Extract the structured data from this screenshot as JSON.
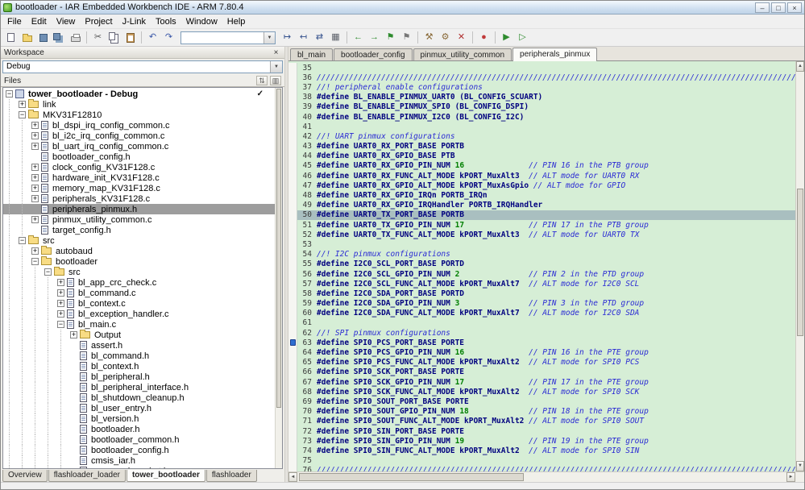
{
  "window": {
    "title": "bootloader - IAR Embedded Workbench IDE - ARM 7.80.4",
    "controls": [
      {
        "name": "minimize-button",
        "glyph": "–"
      },
      {
        "name": "maximize-button",
        "glyph": "□"
      },
      {
        "name": "close-button",
        "glyph": "×"
      }
    ]
  },
  "menu": {
    "items": [
      "File",
      "Edit",
      "View",
      "Project",
      "J-Link",
      "Tools",
      "Window",
      "Help"
    ]
  },
  "toolbar": {
    "items": [
      {
        "type": "icon",
        "name": "new-document-icon",
        "shape": "page"
      },
      {
        "type": "icon",
        "name": "open-file-icon",
        "shape": "folder"
      },
      {
        "type": "icon",
        "name": "save-icon",
        "shape": "floppy"
      },
      {
        "type": "icon",
        "name": "save-all-icon",
        "shape": "floppy2"
      },
      {
        "type": "icon",
        "name": "print-icon",
        "shape": "printer"
      },
      {
        "type": "sep"
      },
      {
        "type": "icon",
        "name": "cut-icon",
        "glyph": "✂",
        "color": "#555555"
      },
      {
        "type": "icon",
        "name": "copy-icon",
        "shape": "copy"
      },
      {
        "type": "icon",
        "name": "paste-icon",
        "shape": "paste"
      },
      {
        "type": "sep"
      },
      {
        "type": "icon",
        "name": "undo-icon",
        "glyph": "↶",
        "color": "#3a57a8"
      },
      {
        "type": "icon",
        "name": "redo-icon",
        "glyph": "↷",
        "color": "#3a57a8"
      },
      {
        "type": "combo",
        "name": "find-combo",
        "value": ""
      },
      {
        "type": "icon",
        "name": "find-next-icon",
        "glyph": "↦",
        "color": "#33508c"
      },
      {
        "type": "icon",
        "name": "find-previous-icon",
        "glyph": "↤",
        "color": "#33508c"
      },
      {
        "type": "icon",
        "name": "replace-icon",
        "glyph": "⇄",
        "color": "#33508c"
      },
      {
        "type": "icon",
        "name": "browse-symbols-icon",
        "glyph": "▦",
        "color": "#5a5f68"
      },
      {
        "type": "sep"
      },
      {
        "type": "icon",
        "name": "navigate-backward-icon",
        "glyph": "←",
        "color": "#2e8b2e"
      },
      {
        "type": "icon",
        "name": "navigate-forward-icon",
        "glyph": "→",
        "color": "#2e8b2e"
      },
      {
        "type": "icon",
        "name": "goto-bookmark-icon",
        "glyph": "⚑",
        "color": "#2e8b2e"
      },
      {
        "type": "icon",
        "name": "toggle-bookmark-icon",
        "glyph": "⚑",
        "color": "#777777"
      },
      {
        "type": "sep"
      },
      {
        "type": "icon",
        "name": "make-icon",
        "glyph": "⚒",
        "color": "#8a6b3a"
      },
      {
        "type": "icon",
        "name": "compile-icon",
        "glyph": "⚙",
        "color": "#8a6b3a"
      },
      {
        "type": "icon",
        "name": "stop-build-icon",
        "glyph": "✕",
        "color": "#b03030"
      },
      {
        "type": "sep"
      },
      {
        "type": "icon",
        "name": "toggle-breakpoint-icon",
        "glyph": "●",
        "color": "#c03a3a"
      },
      {
        "type": "sep"
      },
      {
        "type": "icon",
        "name": "download-and-debug-icon",
        "glyph": "▶",
        "color": "#2e8b2e"
      },
      {
        "type": "icon",
        "name": "debug-without-downloading-icon",
        "glyph": "▷",
        "color": "#2e8b2e"
      }
    ]
  },
  "workspace": {
    "header": "Workspace",
    "config_selector": "Debug",
    "files_header": "Files",
    "files_icons": [
      {
        "name": "files-sort-icon",
        "glyph": "⇅"
      },
      {
        "name": "files-columns-icon",
        "glyph": "▥"
      }
    ],
    "tree": [
      {
        "label": "tower_bootloader - Debug",
        "level": 0,
        "icon": "project",
        "expander": "minus",
        "bold": true,
        "check": true
      },
      {
        "label": "link",
        "level": 1,
        "icon": "folder",
        "expander": "plus"
      },
      {
        "label": "MKV31F12810",
        "level": 1,
        "icon": "folder",
        "expander": "minus"
      },
      {
        "label": "bl_dspi_irq_config_common.c",
        "level": 2,
        "icon": "file",
        "expander": "plus"
      },
      {
        "label": "bl_i2c_irq_config_common.c",
        "level": 2,
        "icon": "file",
        "expander": "plus"
      },
      {
        "label": "bl_uart_irq_config_common.c",
        "level": 2,
        "icon": "file",
        "expander": "plus"
      },
      {
        "label": "bootloader_config.h",
        "level": 2,
        "icon": "file",
        "expander": "none"
      },
      {
        "label": "clock_config_KV31F128.c",
        "level": 2,
        "icon": "file",
        "expander": "plus"
      },
      {
        "label": "hardware_init_KV31F128.c",
        "level": 2,
        "icon": "file",
        "expander": "plus"
      },
      {
        "label": "memory_map_KV31F128.c",
        "level": 2,
        "icon": "file",
        "expander": "plus"
      },
      {
        "label": "peripherals_KV31F128.c",
        "level": 2,
        "icon": "file",
        "expander": "plus"
      },
      {
        "label": "peripherals_pinmux.h",
        "level": 2,
        "icon": "file",
        "expander": "none",
        "selected": true
      },
      {
        "label": "pinmux_utility_common.c",
        "level": 2,
        "icon": "file",
        "expander": "plus"
      },
      {
        "label": "target_config.h",
        "level": 2,
        "icon": "file",
        "expander": "none"
      },
      {
        "label": "src",
        "level": 1,
        "icon": "folder",
        "expander": "minus"
      },
      {
        "label": "autobaud",
        "level": 2,
        "icon": "folder",
        "expander": "plus"
      },
      {
        "label": "bootloader",
        "level": 2,
        "icon": "folder",
        "expander": "minus"
      },
      {
        "label": "src",
        "level": 3,
        "icon": "folder",
        "expander": "minus"
      },
      {
        "label": "bl_app_crc_check.c",
        "level": 4,
        "icon": "file",
        "expander": "plus"
      },
      {
        "label": "bl_command.c",
        "level": 4,
        "icon": "file",
        "expander": "plus"
      },
      {
        "label": "bl_context.c",
        "level": 4,
        "icon": "file",
        "expander": "plus"
      },
      {
        "label": "bl_exception_handler.c",
        "level": 4,
        "icon": "file",
        "expander": "plus"
      },
      {
        "label": "bl_main.c",
        "level": 4,
        "icon": "file",
        "expander": "minus"
      },
      {
        "label": "Output",
        "level": 5,
        "icon": "folder",
        "expander": "plus"
      },
      {
        "label": "assert.h",
        "level": 5,
        "icon": "file",
        "expander": "none"
      },
      {
        "label": "bl_command.h",
        "level": 5,
        "icon": "file",
        "expander": "none"
      },
      {
        "label": "bl_context.h",
        "level": 5,
        "icon": "file",
        "expander": "none"
      },
      {
        "label": "bl_peripheral.h",
        "level": 5,
        "icon": "file",
        "expander": "none"
      },
      {
        "label": "bl_peripheral_interface.h",
        "level": 5,
        "icon": "file",
        "expander": "none"
      },
      {
        "label": "bl_shutdown_cleanup.h",
        "level": 5,
        "icon": "file",
        "expander": "none"
      },
      {
        "label": "bl_user_entry.h",
        "level": 5,
        "icon": "file",
        "expander": "none"
      },
      {
        "label": "bl_version.h",
        "level": 5,
        "icon": "file",
        "expander": "none"
      },
      {
        "label": "bootloader.h",
        "level": 5,
        "icon": "file",
        "expander": "none"
      },
      {
        "label": "bootloader_common.h",
        "level": 5,
        "icon": "file",
        "expander": "none"
      },
      {
        "label": "bootloader_config.h",
        "level": 5,
        "icon": "file",
        "expander": "none"
      },
      {
        "label": "cmsis_iar.h",
        "level": 5,
        "icon": "file",
        "expander": "none"
      },
      {
        "label": "command_packet.h",
        "level": 5,
        "icon": "file",
        "expander": "none"
      }
    ],
    "tabs": [
      {
        "label": "Overview"
      },
      {
        "label": "flashloader_loader"
      },
      {
        "label": "tower_bootloader",
        "active": true
      },
      {
        "label": "flashloader"
      }
    ]
  },
  "editor": {
    "tabs": [
      {
        "label": "bl_main"
      },
      {
        "label": "bootloader_config"
      },
      {
        "label": "pinmux_utility_common"
      },
      {
        "label": "peripherals_pinmux",
        "active": true
      }
    ],
    "lines": [
      {
        "n": 35,
        "t": []
      },
      {
        "n": 36,
        "t": [
          [
            "c",
            "////////////////////////////////////////////////////////////////////////////////////////////////////////"
          ]
        ]
      },
      {
        "n": 37,
        "t": [
          [
            "c",
            "//! peripheral enable configurations"
          ]
        ]
      },
      {
        "n": 38,
        "t": [
          [
            "k",
            "#define BL_ENABLE_PINMUX_UART0 (BL_CONFIG_SCUART)"
          ]
        ]
      },
      {
        "n": 39,
        "t": [
          [
            "k",
            "#define BL_ENABLE_PINMUX_SPI0 (BL_CONFIG_DSPI)"
          ]
        ]
      },
      {
        "n": 40,
        "t": [
          [
            "k",
            "#define BL_ENABLE_PINMUX_I2C0 (BL_CONFIG_I2C)"
          ]
        ]
      },
      {
        "n": 41,
        "t": []
      },
      {
        "n": 42,
        "t": [
          [
            "c",
            "//! UART pinmux configurations"
          ]
        ]
      },
      {
        "n": 43,
        "t": [
          [
            "k",
            "#define UART0_RX_PORT_BASE PORTB"
          ]
        ]
      },
      {
        "n": 44,
        "t": [
          [
            "k",
            "#define UART0_RX_GPIO_BASE PTB"
          ]
        ]
      },
      {
        "n": 45,
        "t": [
          [
            "k",
            "#define UART0_RX_GPIO_PIN_NUM "
          ],
          [
            "n",
            "16"
          ],
          [
            "c",
            "              // PIN 16 in the PTB group"
          ]
        ]
      },
      {
        "n": 46,
        "t": [
          [
            "k",
            "#define UART0_RX_FUNC_ALT_MODE kPORT_MuxAlt3"
          ],
          [
            "c",
            "  // ALT mode for UART0 RX"
          ]
        ]
      },
      {
        "n": 47,
        "t": [
          [
            "k",
            "#define UART0_RX_GPIO_ALT_MODE kPORT_MuxAsGpio"
          ],
          [
            "c",
            " // ALT mdoe for GPIO"
          ]
        ]
      },
      {
        "n": 48,
        "t": [
          [
            "k",
            "#define UART0_RX_GPIO_IRQn PORTB_IRQn"
          ]
        ]
      },
      {
        "n": 49,
        "t": [
          [
            "k",
            "#define UART0_RX_GPIO_IRQHandler PORTB_IRQHandler"
          ]
        ]
      },
      {
        "n": 50,
        "t": [
          [
            "k",
            "#define UART0_TX_PORT_BASE PORTB"
          ]
        ],
        "cur": true
      },
      {
        "n": 51,
        "t": [
          [
            "k",
            "#define UART0_TX_GPIO_PIN_NUM "
          ],
          [
            "n",
            "17"
          ],
          [
            "c",
            "              // PIN 17 in the PTB group"
          ]
        ]
      },
      {
        "n": 52,
        "t": [
          [
            "k",
            "#define UART0_TX_FUNC_ALT_MODE kPORT_MuxAlt3"
          ],
          [
            "c",
            "  // ALT mode for UART0 TX"
          ]
        ]
      },
      {
        "n": 53,
        "t": []
      },
      {
        "n": 54,
        "t": [
          [
            "c",
            "//! I2C pinmux configurations"
          ]
        ]
      },
      {
        "n": 55,
        "t": [
          [
            "k",
            "#define I2C0_SCL_PORT_BASE PORTD"
          ]
        ]
      },
      {
        "n": 56,
        "t": [
          [
            "k",
            "#define I2C0_SCL_GPIO_PIN_NUM "
          ],
          [
            "n",
            "2"
          ],
          [
            "c",
            "               // PIN 2 in the PTD group"
          ]
        ]
      },
      {
        "n": 57,
        "t": [
          [
            "k",
            "#define I2C0_SCL_FUNC_ALT_MODE kPORT_MuxAlt7"
          ],
          [
            "c",
            "  // ALT mode for I2C0 SCL"
          ]
        ]
      },
      {
        "n": 58,
        "t": [
          [
            "k",
            "#define I2C0_SDA_PORT_BASE PORTD"
          ]
        ]
      },
      {
        "n": 59,
        "t": [
          [
            "k",
            "#define I2C0_SDA_GPIO_PIN_NUM "
          ],
          [
            "n",
            "3"
          ],
          [
            "c",
            "               // PIN 3 in the PTD group"
          ]
        ]
      },
      {
        "n": 60,
        "t": [
          [
            "k",
            "#define I2C0_SDA_FUNC_ALT_MODE kPORT_MuxAlt7"
          ],
          [
            "c",
            "  // ALT mode for I2C0 SDA"
          ]
        ]
      },
      {
        "n": 61,
        "t": []
      },
      {
        "n": 62,
        "t": [
          [
            "c",
            "//! SPI pinmux configurations"
          ]
        ]
      },
      {
        "n": 63,
        "t": [
          [
            "k",
            "#define SPI0_PCS_PORT_BASE PORTE"
          ]
        ],
        "mark": true
      },
      {
        "n": 64,
        "t": [
          [
            "k",
            "#define SPI0_PCS_GPIO_PIN_NUM "
          ],
          [
            "n",
            "16"
          ],
          [
            "c",
            "              // PIN 16 in the PTE group"
          ]
        ]
      },
      {
        "n": 65,
        "t": [
          [
            "k",
            "#define SPI0_PCS_FUNC_ALT_MODE kPORT_MuxAlt2"
          ],
          [
            "c",
            "  // ALT mode for SPI0 PCS"
          ]
        ]
      },
      {
        "n": 66,
        "t": [
          [
            "k",
            "#define SPI0_SCK_PORT_BASE PORTE"
          ]
        ]
      },
      {
        "n": 67,
        "t": [
          [
            "k",
            "#define SPI0_SCK_GPIO_PIN_NUM "
          ],
          [
            "n",
            "17"
          ],
          [
            "c",
            "              // PIN 17 in the PTE group"
          ]
        ]
      },
      {
        "n": 68,
        "t": [
          [
            "k",
            "#define SPI0_SCK_FUNC_ALT_MODE kPORT_MuxAlt2"
          ],
          [
            "c",
            "  // ALT mode for SPI0 SCK"
          ]
        ]
      },
      {
        "n": 69,
        "t": [
          [
            "k",
            "#define SPI0_SOUT_PORT_BASE PORTE"
          ]
        ]
      },
      {
        "n": 70,
        "t": [
          [
            "k",
            "#define SPI0_SOUT_GPIO_PIN_NUM "
          ],
          [
            "n",
            "18"
          ],
          [
            "c",
            "             // PIN 18 in the PTE group"
          ]
        ]
      },
      {
        "n": 71,
        "t": [
          [
            "k",
            "#define SPI0_SOUT_FUNC_ALT_MODE kPORT_MuxAlt2"
          ],
          [
            "c",
            " // ALT mode for SPI0 SOUT"
          ]
        ]
      },
      {
        "n": 72,
        "t": [
          [
            "k",
            "#define SPI0_SIN_PORT_BASE PORTE"
          ]
        ]
      },
      {
        "n": 73,
        "t": [
          [
            "k",
            "#define SPI0_SIN_GPIO_PIN_NUM "
          ],
          [
            "n",
            "19"
          ],
          [
            "c",
            "              // PIN 19 in the PTE group"
          ]
        ]
      },
      {
        "n": 74,
        "t": [
          [
            "k",
            "#define SPI0_SIN_FUNC_ALT_MODE kPORT_MuxAlt2"
          ],
          [
            "c",
            "  // ALT mode for SPI0 SIN"
          ]
        ]
      },
      {
        "n": 75,
        "t": []
      },
      {
        "n": 76,
        "t": [
          [
            "c",
            "////////////////////////////////////////////////////////////////////////////////////////////////////////"
          ]
        ]
      }
    ]
  },
  "colors": {
    "editor_background": "#d6eed6",
    "code_text": "#00007f",
    "number_text": "#007f00",
    "comment_text": "#2a2ad4",
    "current_line_highlight": "#a9bfc0",
    "tree_selection": "#9d9d9d"
  }
}
